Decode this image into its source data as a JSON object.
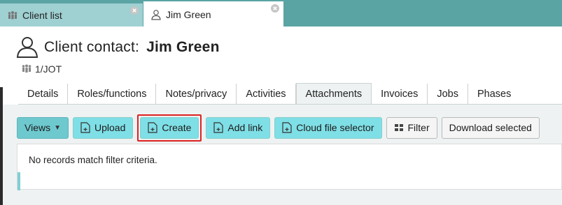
{
  "window_tabs": [
    {
      "label": "Client list",
      "icon": "group-icon",
      "active": false
    },
    {
      "label": "Jim Green",
      "icon": "person-icon",
      "active": true
    }
  ],
  "header": {
    "label": "Client contact:",
    "name": "Jim Green",
    "code": "1/JOT"
  },
  "subtabs": [
    "Details",
    "Roles/functions",
    "Notes/privacy",
    "Activities",
    "Attachments",
    "Invoices",
    "Jobs",
    "Phases"
  ],
  "active_subtab": "Attachments",
  "toolbar": {
    "views": "Views",
    "upload": "Upload",
    "create": "Create",
    "add_link": "Add link",
    "cloud": "Cloud file selector",
    "filter": "Filter",
    "download": "Download selected"
  },
  "results": {
    "message": "No records match filter criteria."
  },
  "colors": {
    "tabstrip": "#5ba4a4",
    "button": "#7fdfe6",
    "highlight": "#dd2222"
  }
}
